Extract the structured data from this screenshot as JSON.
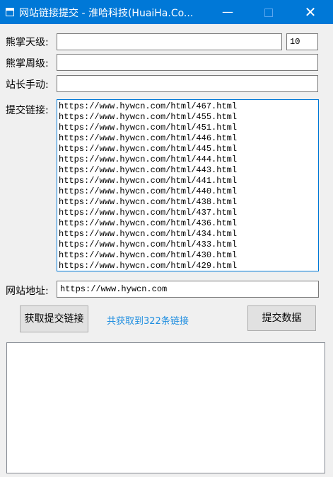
{
  "window": {
    "title": "网站链接提交 - 淮哈科技(HuaiHa.Co...",
    "minimize": "—",
    "close": "✕"
  },
  "form": {
    "sky_label": "熊掌天级:",
    "sky_value": "",
    "count_value": "10",
    "week_label": "熊掌周级:",
    "week_value": "",
    "manual_label": "站长手动:",
    "manual_value": "",
    "links_label": "提交链接:",
    "links": [
      "https://www.hywcn.com/html/467.html",
      "https://www.hywcn.com/html/455.html",
      "https://www.hywcn.com/html/451.html",
      "https://www.hywcn.com/html/446.html",
      "https://www.hywcn.com/html/445.html",
      "https://www.hywcn.com/html/444.html",
      "https://www.hywcn.com/html/443.html",
      "https://www.hywcn.com/html/441.html",
      "https://www.hywcn.com/html/440.html",
      "https://www.hywcn.com/html/438.html",
      "https://www.hywcn.com/html/437.html",
      "https://www.hywcn.com/html/436.html",
      "https://www.hywcn.com/html/434.html",
      "https://www.hywcn.com/html/433.html",
      "https://www.hywcn.com/html/430.html",
      "https://www.hywcn.com/html/429.html"
    ],
    "site_label": "网站地址:",
    "site_value": "https://www.hywcn.com"
  },
  "actions": {
    "fetch_label": "获取提交链接",
    "status_text": "共获取到322条链接",
    "submit_label": "提交数据"
  },
  "colors": {
    "titlebar": "#0078d7",
    "status": "#1f8ee0",
    "background": "#f0f0f0"
  }
}
